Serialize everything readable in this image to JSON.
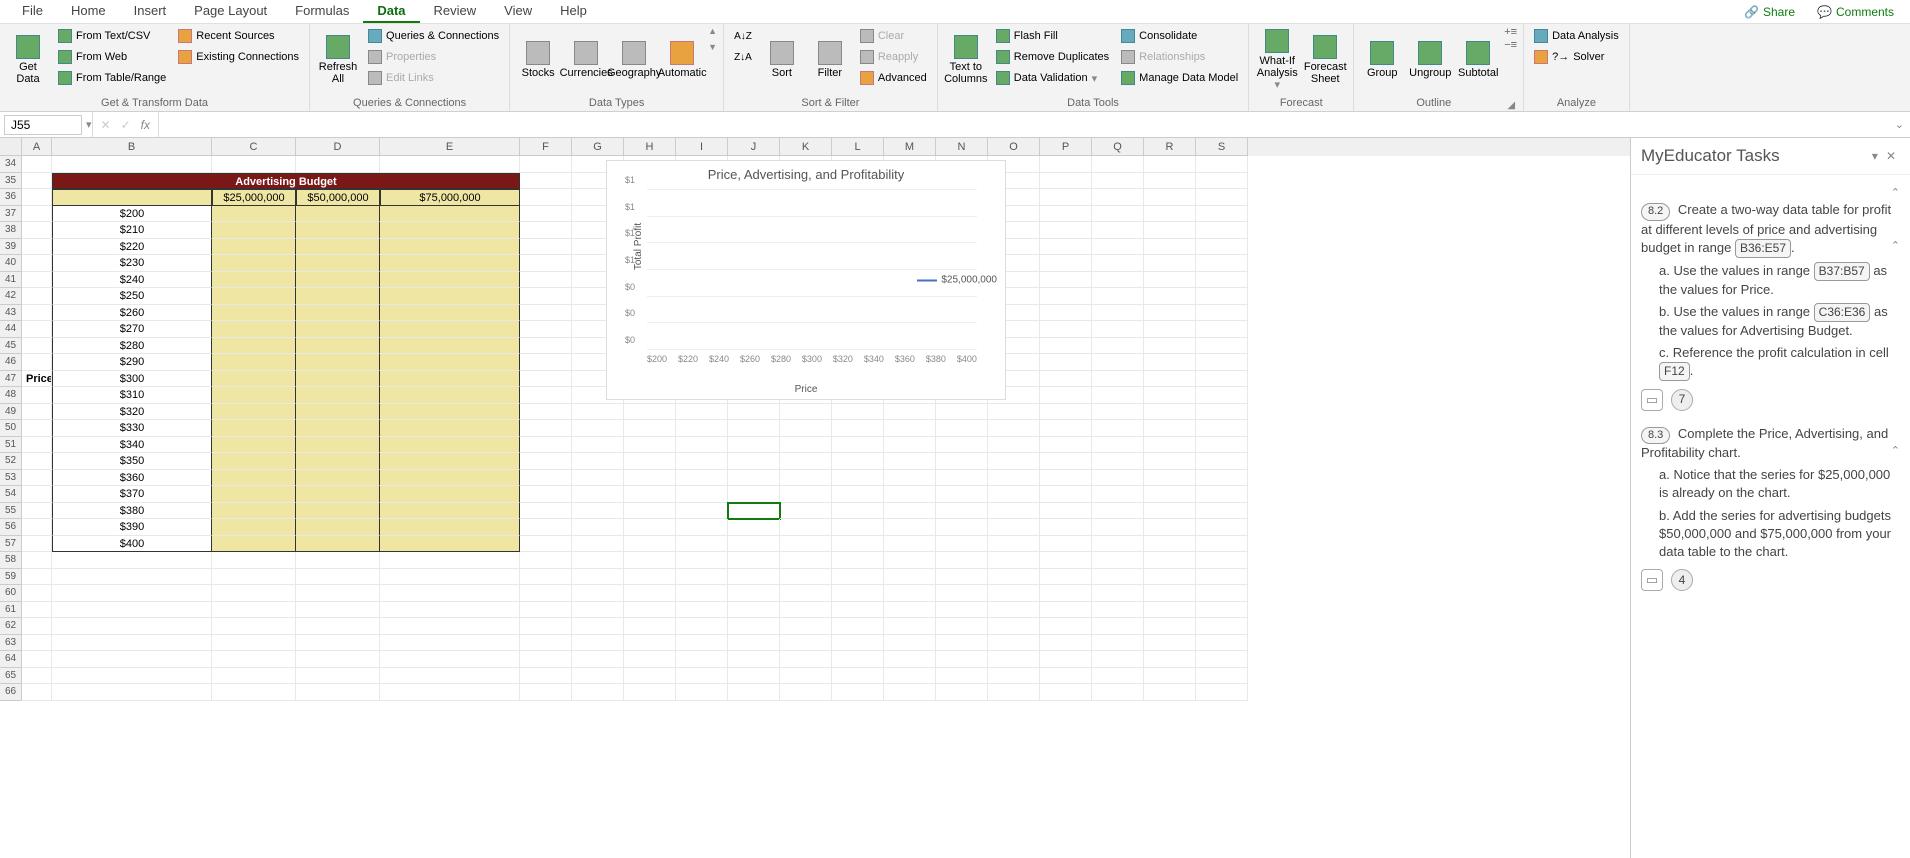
{
  "menu": {
    "tabs": [
      "File",
      "Home",
      "Insert",
      "Page Layout",
      "Formulas",
      "Data",
      "Review",
      "View",
      "Help"
    ],
    "active": "Data",
    "share": "Share",
    "comments": "Comments"
  },
  "ribbon": {
    "groups": {
      "get_transform": {
        "label": "Get & Transform Data",
        "get_data": "Get\nData",
        "from_text": "From Text/CSV",
        "from_web": "From Web",
        "from_table": "From Table/Range",
        "recent": "Recent Sources",
        "existing": "Existing Connections"
      },
      "queries": {
        "label": "Queries & Connections",
        "refresh": "Refresh\nAll",
        "qc": "Queries & Connections",
        "props": "Properties",
        "edit": "Edit Links"
      },
      "types": {
        "label": "Data Types",
        "stocks": "Stocks",
        "currencies": "Currencies",
        "geography": "Geography",
        "automatic": "Automatic"
      },
      "sortfilter": {
        "label": "Sort & Filter",
        "sort": "Sort",
        "filter": "Filter",
        "clear": "Clear",
        "reapply": "Reapply",
        "advanced": "Advanced"
      },
      "tools": {
        "label": "Data Tools",
        "ttc": "Text to\nColumns",
        "flash": "Flash Fill",
        "dup": "Remove Duplicates",
        "dv": "Data Validation",
        "cons": "Consolidate",
        "rel": "Relationships",
        "mdm": "Manage Data Model"
      },
      "forecast": {
        "label": "Forecast",
        "whatif": "What-If\nAnalysis",
        "sheet": "Forecast\nSheet"
      },
      "outline": {
        "label": "Outline",
        "group": "Group",
        "ungroup": "Ungroup",
        "subtotal": "Subtotal"
      },
      "analyze": {
        "label": "Analyze",
        "da": "Data Analysis",
        "solver": "Solver"
      }
    }
  },
  "formula_bar": {
    "name_box": "J55",
    "fx": ""
  },
  "columns": [
    "A",
    "B",
    "C",
    "D",
    "E",
    "F",
    "G",
    "H",
    "I",
    "J",
    "K",
    "L",
    "M",
    "N",
    "O",
    "P",
    "Q",
    "R",
    "S"
  ],
  "row_start": 34,
  "row_count": 33,
  "table": {
    "header": "Advertising Budget",
    "col_labels": [
      "$25,000,000",
      "$50,000,000",
      "$75,000,000"
    ],
    "row_label": "Price",
    "prices": [
      "$200",
      "$210",
      "$220",
      "$230",
      "$240",
      "$250",
      "$260",
      "$270",
      "$280",
      "$290",
      "$300",
      "$310",
      "$320",
      "$330",
      "$340",
      "$350",
      "$360",
      "$370",
      "$380",
      "$390",
      "$400"
    ]
  },
  "selected_cell": "J55",
  "chart_data": {
    "type": "line",
    "title": "Price, Advertising, and Profitability",
    "xlabel": "Price",
    "ylabel": "Total Profit",
    "x_ticks": [
      "$200",
      "$220",
      "$240",
      "$260",
      "$280",
      "$300",
      "$320",
      "$340",
      "$360",
      "$380",
      "$400"
    ],
    "y_ticks": [
      "$0",
      "$0",
      "$0",
      "$1",
      "$1",
      "$1",
      "$1"
    ],
    "series": [
      {
        "name": "$25,000,000",
        "values": [
          0,
          0,
          0,
          0,
          0,
          0,
          0,
          0,
          0,
          0,
          0
        ]
      }
    ]
  },
  "task_pane": {
    "title": "MyEducator Tasks",
    "tasks": [
      {
        "num": "8.2",
        "text": "Create a two-way data table for profit at different levels of price and advertising budget in range ",
        "ref1": "B36:E57",
        "tail1": ".",
        "subs": [
          {
            "prefix": "a. Use the values in range ",
            "ref": "B37:B57",
            "tail": " as the values for Price."
          },
          {
            "prefix": "b. Use the values in range ",
            "ref": "C36:E36",
            "tail": " as the values for Advertising Budget."
          },
          {
            "prefix": "c. Reference the profit calculation in cell ",
            "ref": "F12",
            "tail": "."
          }
        ],
        "count": "7"
      },
      {
        "num": "8.3",
        "text": "Complete the Price, Advertising, and Profitability chart.",
        "subs": [
          {
            "prefix": "a. Notice that the series for $25,000,000 is already on the chart.",
            "ref": "",
            "tail": ""
          },
          {
            "prefix": "b. Add the series for advertising budgets $50,000,000 and $75,000,000 from your data table to the chart.",
            "ref": "",
            "tail": ""
          }
        ],
        "count": "4"
      }
    ]
  }
}
